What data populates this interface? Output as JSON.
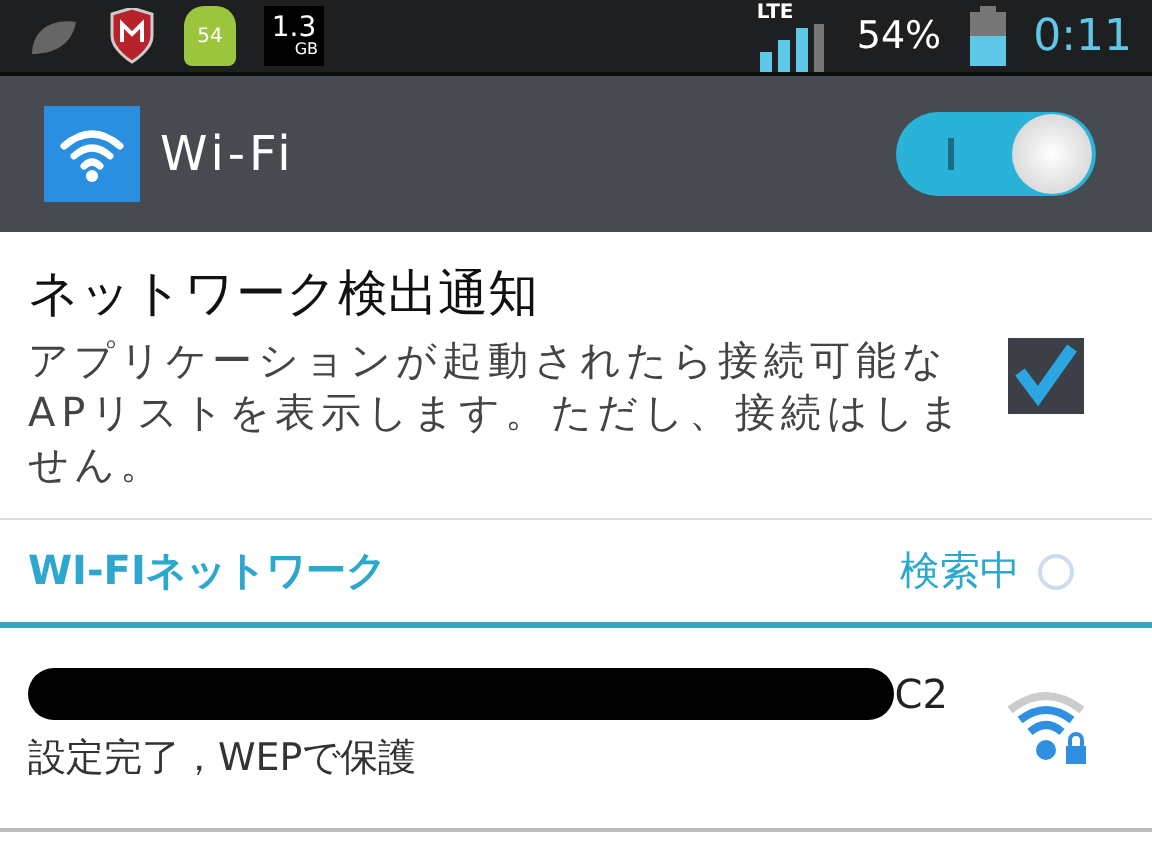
{
  "status_bar": {
    "storage_badge": {
      "value": "1.3",
      "unit": "GB"
    },
    "app_badge": "54",
    "network": "LTE",
    "battery": "54%",
    "time": "0:11"
  },
  "header": {
    "title": "Wi-Fi",
    "switch_on": true
  },
  "notification": {
    "title": "ネットワーク検出通知",
    "description": "アプリケーションが起動されたら接続可能なAPリストを表示します。ただし、接続はしません。",
    "checked": true
  },
  "section": {
    "title": "WI-FIネットワーク",
    "status": "検索中"
  },
  "networks": [
    {
      "name_visible": "C2",
      "status": "設定完了，WEPで保護",
      "secured": true
    }
  ]
}
